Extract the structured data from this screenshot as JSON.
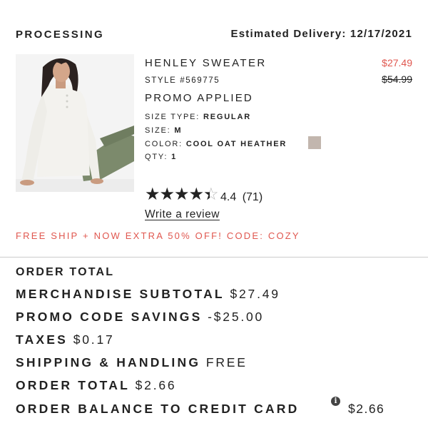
{
  "order": {
    "status": "PROCESSING",
    "estimated_delivery": "Estimated Delivery: 12/17/2021"
  },
  "product": {
    "name": "HENLEY SWEATER",
    "style": "STYLE #569775",
    "promo": "PROMO APPLIED",
    "price": "$27.49",
    "original_price": "$54.99",
    "size_type_label": "SIZE TYPE:",
    "size_type": "REGULAR",
    "size_label": "SIZE:",
    "size": "M",
    "color_label": "COLOR:",
    "color": "COOL OAT HEATHER",
    "color_swatch": "#c2b6ae",
    "qty_label": "QTY:",
    "qty": "1",
    "rating_stars": 4.4,
    "rating_text": "4.4",
    "review_count": "(71)",
    "write_review": "Write a review"
  },
  "offer_banner": "FREE SHIP + NOW EXTRA 50% OFF! CODE: COZY",
  "summary": {
    "heading": "ORDER TOTAL",
    "merchandise_label": "MERCHANDISE SUBTOTAL",
    "merchandise_value": "$27.49",
    "promo_label": "PROMO CODE SAVINGS",
    "promo_value": "-$25.00",
    "taxes_label": "TAXES",
    "taxes_value": "$0.17",
    "shipping_label": "SHIPPING & HANDLING",
    "shipping_value": "FREE",
    "total_label": "ORDER TOTAL",
    "total_value": "$2.66",
    "balance_label": "ORDER BALANCE TO CREDIT CARD",
    "balance_value": "$2.66",
    "info_icon": "info-circle-icon"
  },
  "colors": {
    "accent_red": "#e0574f",
    "text": "#222222"
  }
}
